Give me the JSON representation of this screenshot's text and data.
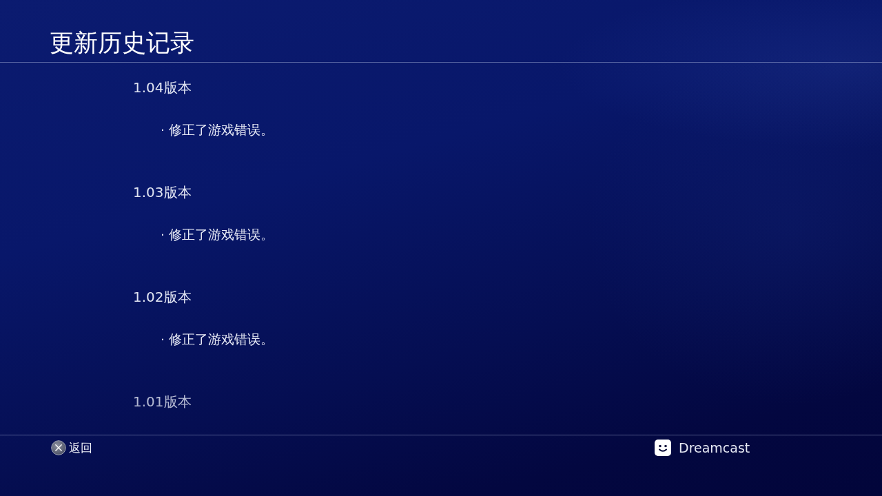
{
  "header": {
    "title": "更新历史记录"
  },
  "versions": [
    {
      "label": "1.04版本",
      "notes": [
        "· 修正了游戏错误。"
      ]
    },
    {
      "label": "1.03版本",
      "notes": [
        "· 修正了游戏错误。"
      ]
    },
    {
      "label": "1.02版本",
      "notes": [
        "· 修正了游戏错误。"
      ]
    },
    {
      "label": "1.01版本"
    }
  ],
  "footer": {
    "back_hint": "返回",
    "user": "Dreamcast"
  }
}
